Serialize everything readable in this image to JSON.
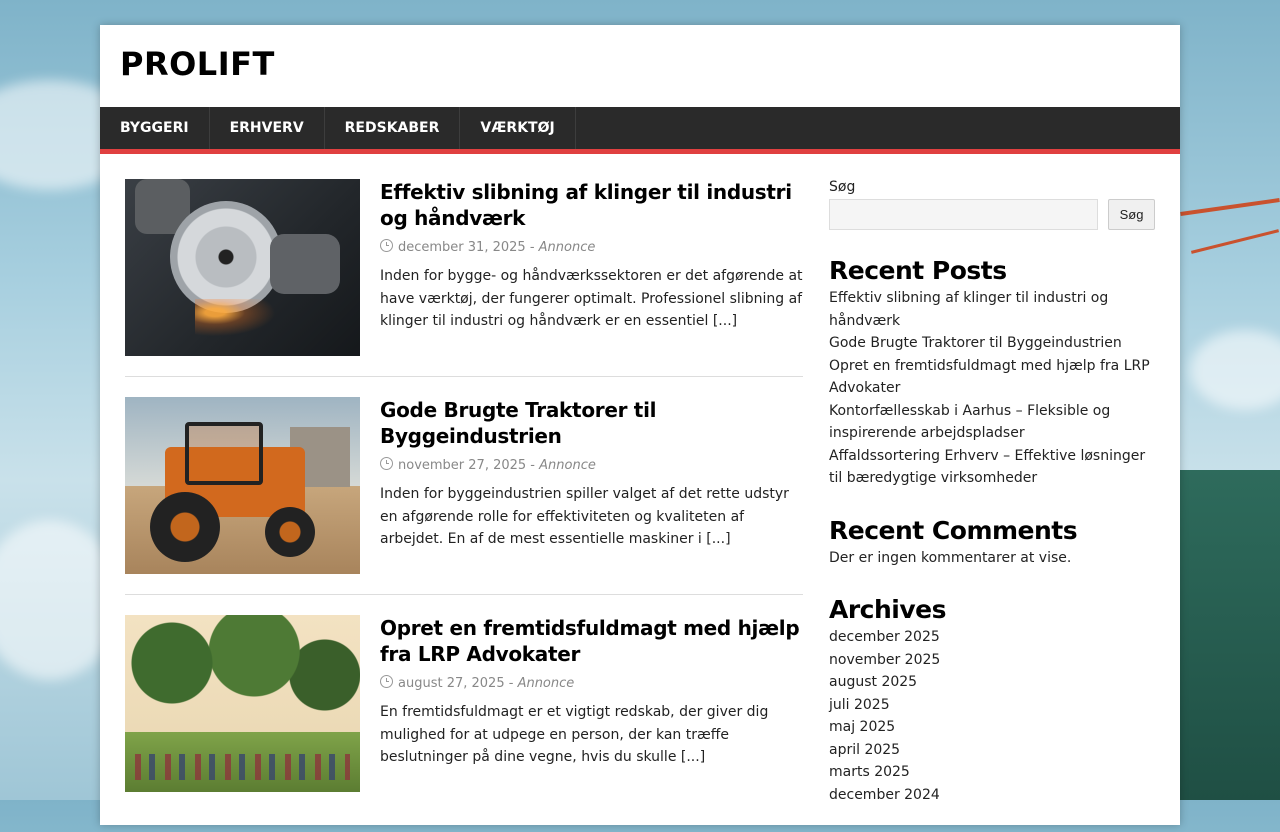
{
  "site": {
    "title": "PROLIFT"
  },
  "nav": {
    "items": [
      "BYGGERI",
      "ERHVERV",
      "REDSKABER",
      "VÆRKTØJ"
    ]
  },
  "posts": [
    {
      "title": "Effektiv slibning af klinger til industri og håndværk",
      "date": "december 31, 2025",
      "separator": " - ",
      "author": "Annonce",
      "excerpt": "Inden for bygge- og håndværkssektoren er det afgørende at have værktøj, der fungerer optimalt. Professionel slibning af klinger til industri og håndværk er en essentiel",
      "more": "[...]",
      "image_icon": "saw-blade-image"
    },
    {
      "title": "Gode Brugte Traktorer til Byggeindustrien",
      "date": "november 27, 2025",
      "separator": " - ",
      "author": "Annonce",
      "excerpt": "Inden for byggeindustrien spiller valget af det rette udstyr en afgørende rolle for effektiviteten og kvaliteten af arbejdet. En af de mest essentielle maskiner i",
      "more": "[...]",
      "image_icon": "tractor-image"
    },
    {
      "title": "Opret en fremtidsfuldmagt med hjælp fra LRP Advokater",
      "date": "august 27, 2025",
      "separator": " - ",
      "author": "Annonce",
      "excerpt": "En fremtidsfuldmagt er et vigtigt redskab, der giver dig mulighed for at udpege en person, der kan træffe beslutninger på dine vegne, hvis du skulle",
      "more": "[...]",
      "image_icon": "park-image"
    }
  ],
  "sidebar": {
    "search": {
      "label": "Søg",
      "placeholder": "",
      "value": "",
      "button_label": "Søg"
    },
    "recent_posts": {
      "title": "Recent Posts",
      "items": [
        "Effektiv slibning af klinger til industri og håndværk",
        "Gode Brugte Traktorer til Byggeindustrien",
        "Opret en fremtidsfuldmagt med hjælp fra LRP Advokater",
        "Kontorfællesskab i Aarhus – Fleksible og inspirerende arbejdspladser",
        "Affaldssortering Erhverv – Effektive løsninger til bæredygtige virksomheder"
      ]
    },
    "recent_comments": {
      "title": "Recent Comments",
      "text": "Der er ingen kommentarer at vise."
    },
    "archives": {
      "title": "Archives",
      "items": [
        "december 2025",
        "november 2025",
        "august 2025",
        "juli 2025",
        "maj 2025",
        "april 2025",
        "marts 2025",
        "december 2024"
      ]
    }
  },
  "colors": {
    "nav_bg": "#2a2a2a",
    "nav_accent": "#e04040",
    "page_bg": "#ffffff"
  }
}
